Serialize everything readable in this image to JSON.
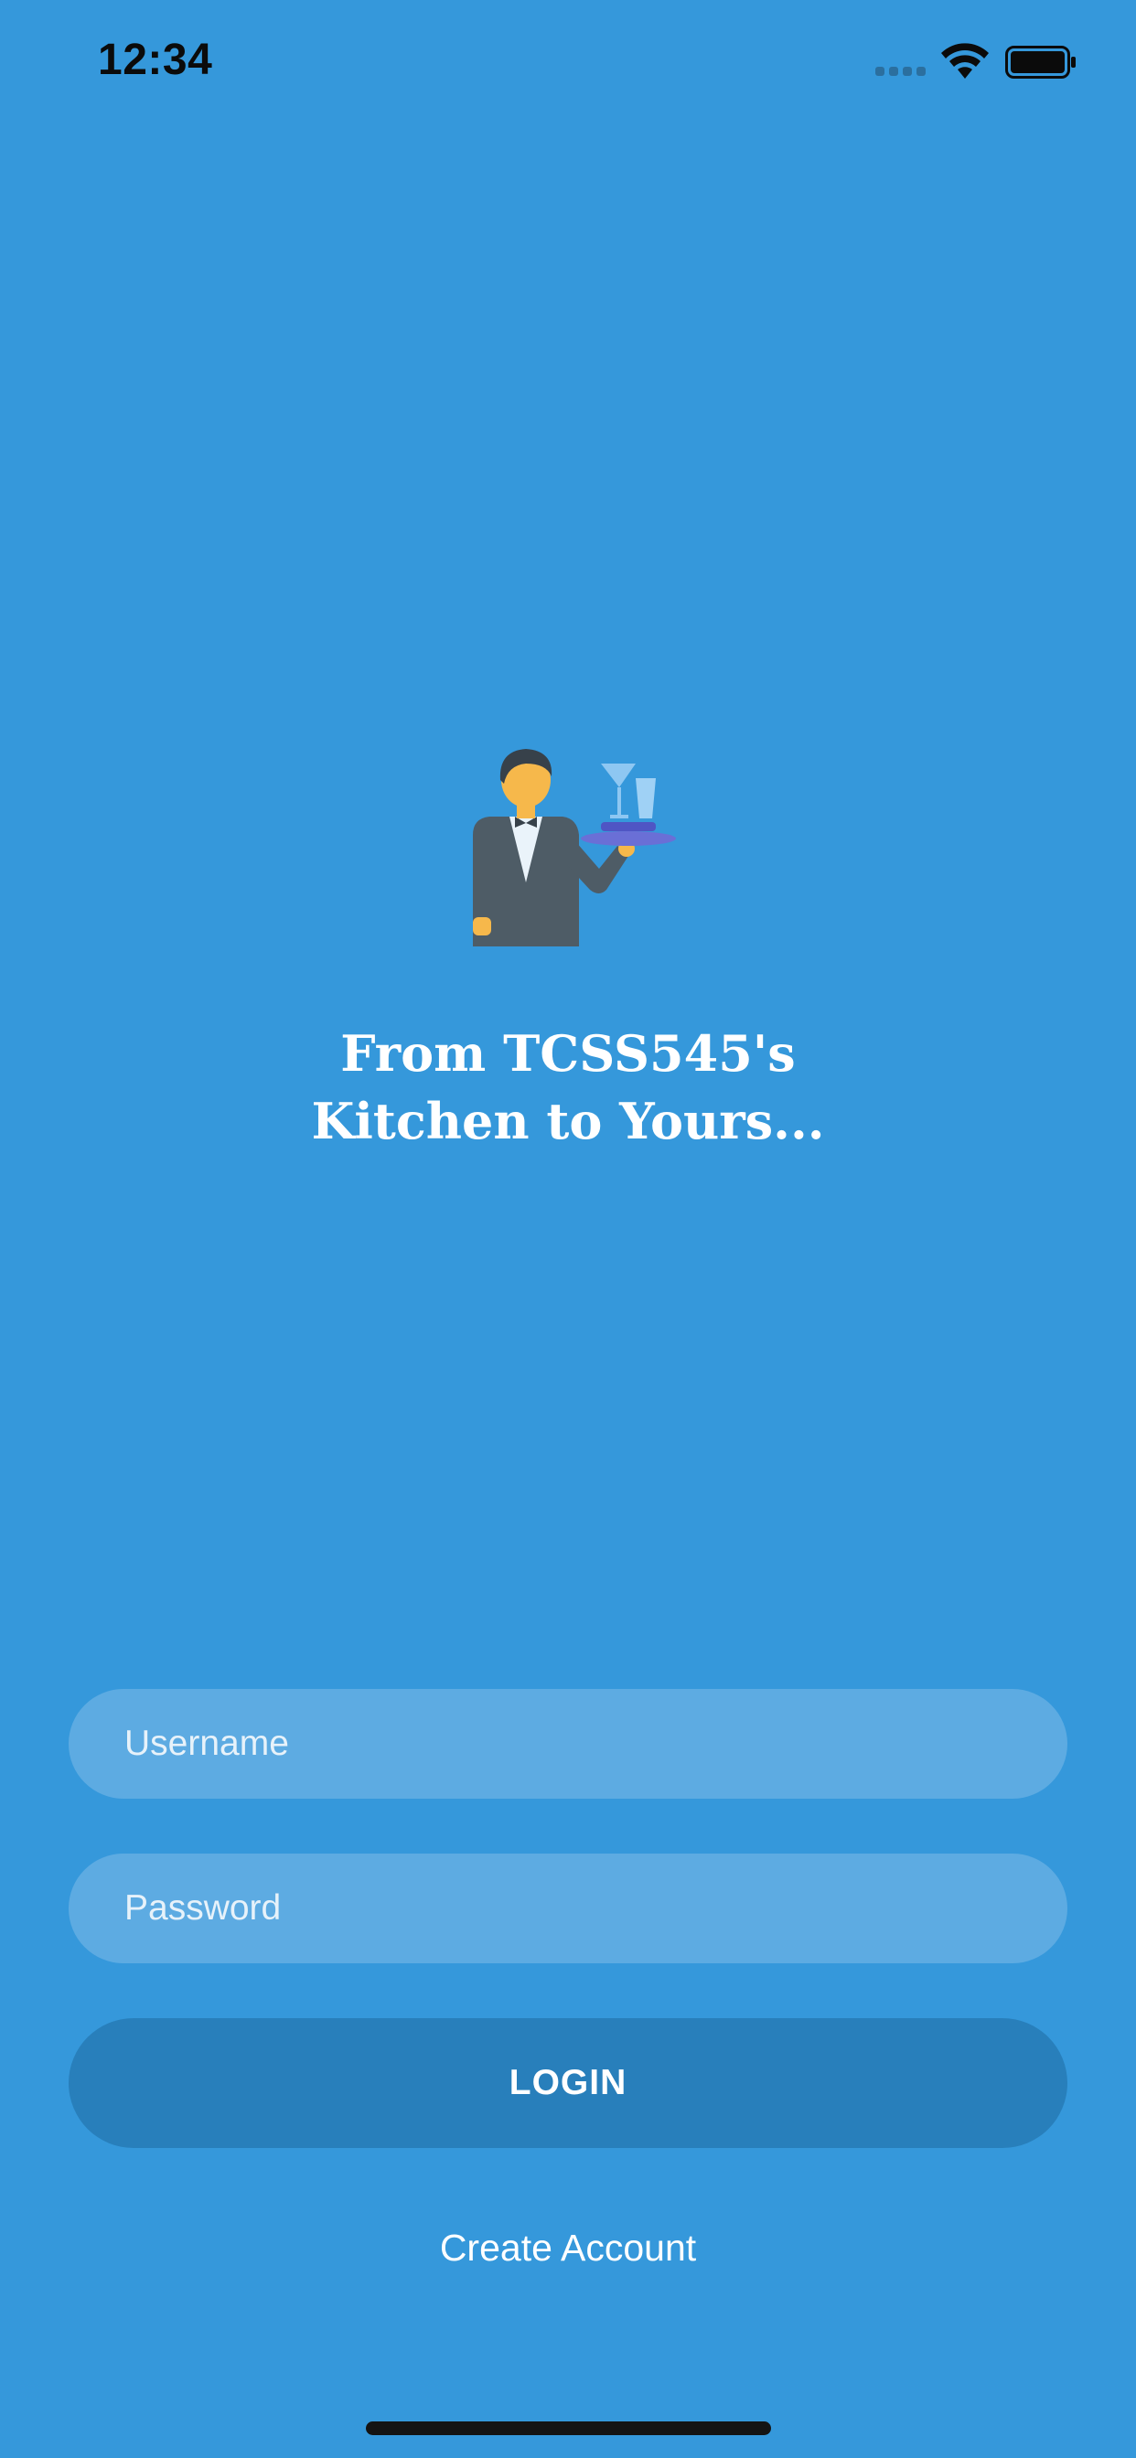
{
  "status_bar": {
    "time": "12:34",
    "icons": [
      "signal-icon",
      "wifi-icon",
      "battery-icon"
    ]
  },
  "hero": {
    "logo_icon": "waiter-icon",
    "tagline_line1": "From TCSS545's",
    "tagline_line2": "Kitchen to Yours..."
  },
  "form": {
    "username_placeholder": "Username",
    "username_value": "",
    "password_placeholder": "Password",
    "password_value": "",
    "login_label": "LOGIN",
    "create_account_label": "Create Account"
  },
  "colors": {
    "background": "#3598db",
    "input_fill": "#5dabe2",
    "button_fill": "#287fbb",
    "text": "#ffffff"
  }
}
